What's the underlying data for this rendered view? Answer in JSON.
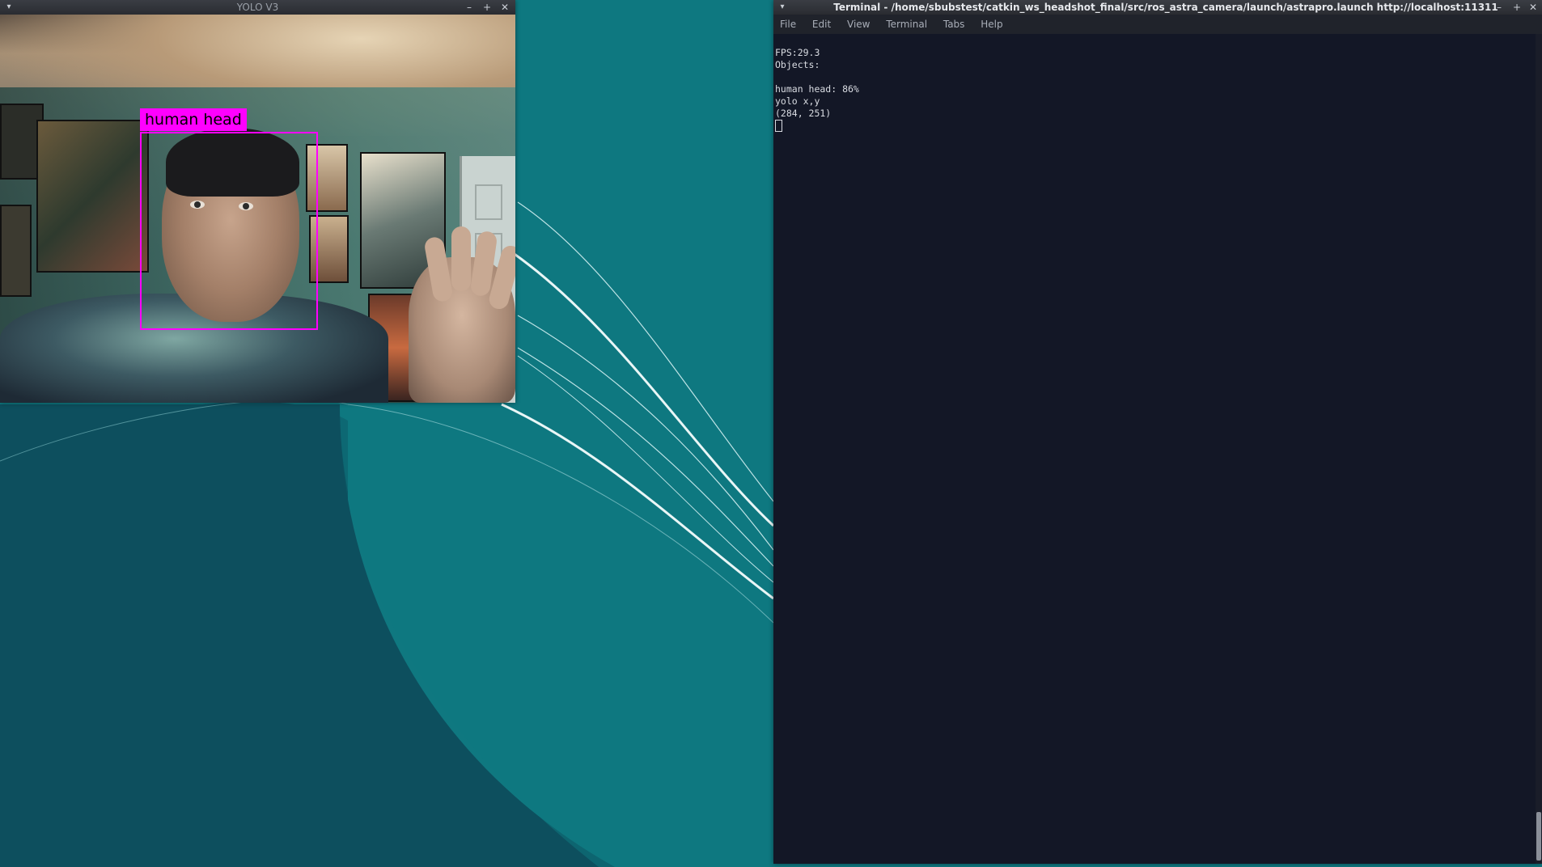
{
  "yolo_window": {
    "title": "YOLO V3",
    "detection": {
      "label": "human head",
      "box_color": "#ff00ff"
    }
  },
  "terminal_window": {
    "title": "Terminal - /home/sbubstest/catkin_ws_headshot_final/src/ros_astra_camera/launch/astrapro.launch http://localhost:11311",
    "menu": [
      "File",
      "Edit",
      "View",
      "Terminal",
      "Tabs",
      "Help"
    ],
    "lines": [
      "FPS:29.3",
      "Objects:",
      "",
      "human head: 86%",
      "yolo x,y",
      "(284, 251)"
    ]
  },
  "window_controls": {
    "minimize": "–",
    "maximize": "+",
    "close": "✕"
  },
  "colors": {
    "desktop": "#0f6f78",
    "terminal_bg": "#131726",
    "bbox": "#ff00ff"
  }
}
